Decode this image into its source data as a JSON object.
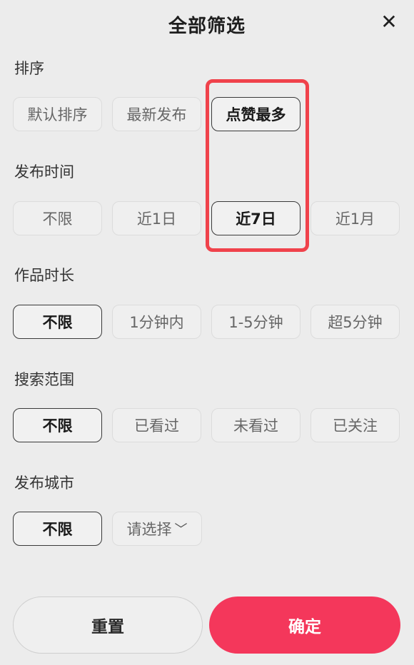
{
  "header": {
    "title": "全部筛选",
    "close_icon": "close-icon",
    "close_glyph": "✕"
  },
  "sections": {
    "sort": {
      "title": "排序",
      "options": [
        "默认排序",
        "最新发布",
        "点赞最多"
      ],
      "selected": "点赞最多"
    },
    "publish_time": {
      "title": "发布时间",
      "options": [
        "不限",
        "近1日",
        "近7日",
        "近1月"
      ],
      "selected": "近7日"
    },
    "duration": {
      "title": "作品时长",
      "options": [
        "不限",
        "1分钟内",
        "1-5分钟",
        "超5分钟"
      ],
      "selected": "不限"
    },
    "scope": {
      "title": "搜索范围",
      "options": [
        "不限",
        "已看过",
        "未看过",
        "已关注"
      ],
      "selected": "不限"
    },
    "city": {
      "title": "发布城市",
      "options": [
        "不限",
        "请选择"
      ],
      "selected": "不限",
      "dropdown_icon": "chevron-down-icon",
      "dropdown_glyph": "﹀"
    }
  },
  "footer": {
    "reset_label": "重置",
    "confirm_label": "确定"
  },
  "colors": {
    "accent": "#f4375b",
    "highlight_box": "#f0424b",
    "background": "#ececec"
  }
}
